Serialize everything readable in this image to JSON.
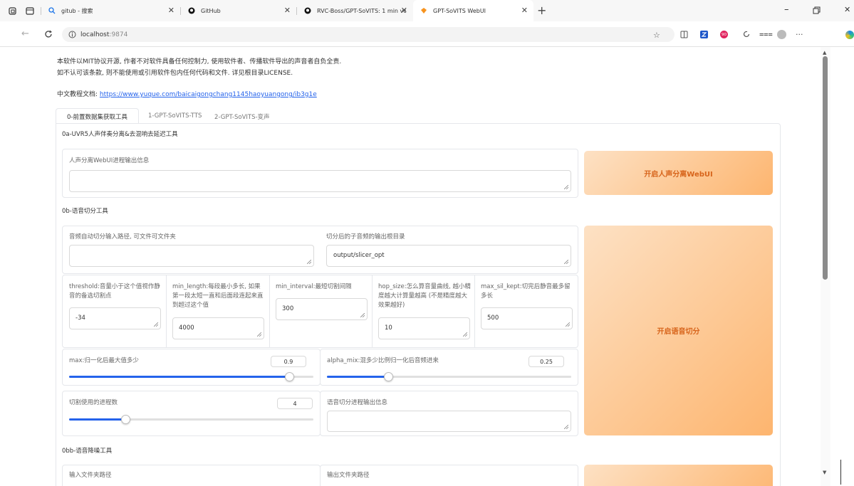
{
  "browser": {
    "tabs": [
      {
        "title": "gitub - 搜索"
      },
      {
        "title": "GitHub"
      },
      {
        "title": "RVC-Boss/GPT-SoVITS: 1 min voic"
      },
      {
        "title": "GPT-SoVITS WebUI"
      }
    ],
    "new_tab": "+",
    "url": "localhost",
    "url_port": ":9874",
    "badge_count": "90"
  },
  "intro": {
    "line1": "本软件以MIT协议开源, 作者不对软件具备任何控制力, 使用软件者、传播软件导出的声音者自负全责.",
    "line2": "如不认可该条款, 则不能使用或引用软件包内任何代码和文件. 详见根目录LICENSE.",
    "docs_label": "中文教程文档:",
    "docs_link": "https://www.yuque.com/baicaigongchang1145haoyuangong/ib3g1e"
  },
  "main_tabs": [
    "0-前置数据集获取工具",
    "1-GPT-SoVITS-TTS",
    "2-GPT-SoVITS-变声"
  ],
  "uvr": {
    "section_title": "0a-UVR5人声伴奏分离&去混响去延迟工具",
    "output_label": "人声分离WebUI进程输出信息",
    "button": "开启人声分离WebUI"
  },
  "slicer": {
    "section_title": "0b-语音切分工具",
    "input_label": "音频自动切分输入路径, 可文件可文件夹",
    "output_dir_label": "切分后的子音频的输出根目录",
    "output_dir_value": "output/slicer_opt",
    "threshold_label": "threshold:音量小于这个值视作静音的备选切割点",
    "threshold_value": "-34",
    "min_length_label": "min_length:每段最小多长, 如果第一段太短一直和后面段连起来直到超过这个值",
    "min_length_value": "4000",
    "min_interval_label": "min_interval:最短切割间隔",
    "min_interval_value": "300",
    "hop_size_label": "hop_size:怎么算音量曲线, 越小精度越大计算量越高 (不是精度越大效果越好)",
    "hop_size_value": "10",
    "max_sil_label": "max_sil_kept:切完后静音最多留多长",
    "max_sil_value": "500",
    "max_label": "max:归一化后最大值多少",
    "max_value": "0.9",
    "max_fraction": 0.9,
    "alpha_label": "alpha_mix:混多少比例归一化后音频进来",
    "alpha_value": "0.25",
    "alpha_fraction": 0.25,
    "procs_label": "切割使用的进程数",
    "procs_value": "4",
    "procs_fraction": 0.23,
    "progress_label": "语音切分进程输出信息",
    "button": "开启语音切分"
  },
  "denoise": {
    "section_title": "0bb-语音降噪工具",
    "input_label": "输入文件夹路径",
    "output_label": "输出文件夹路径"
  },
  "colors": {
    "accent": "#2563eb",
    "button_text": "#d7641b",
    "button_start": "#fde1c4",
    "button_end": "#fdb56f"
  }
}
